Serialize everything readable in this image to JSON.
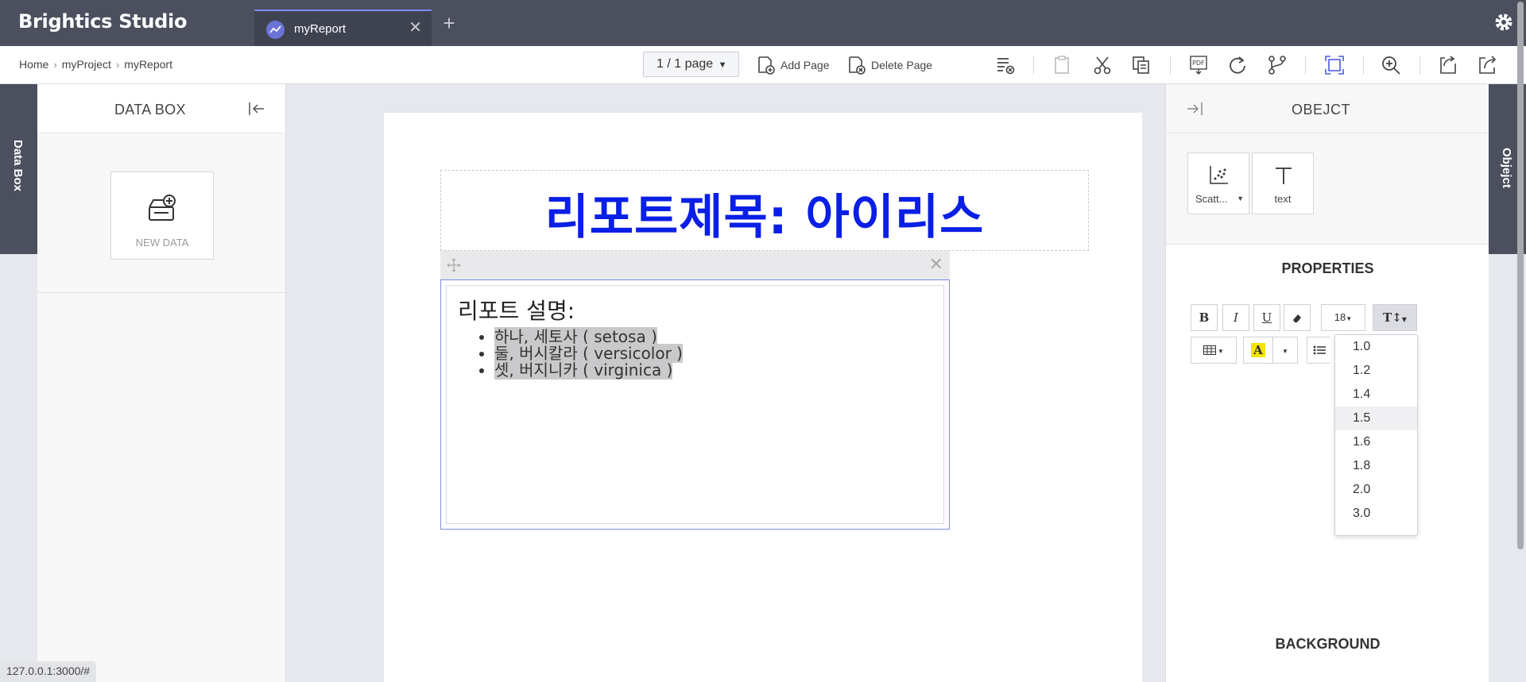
{
  "app": {
    "title": "Brightics Studio"
  },
  "tabs": [
    {
      "label": "myReport"
    }
  ],
  "breadcrumb": [
    "Home",
    "myProject",
    "myReport"
  ],
  "toolbar": {
    "page_select": "1 / 1 page",
    "add_page": "Add Page",
    "delete_page": "Delete Page"
  },
  "left_vtab": "Data Box",
  "right_vtab": "Objejct",
  "databox": {
    "title": "DATA BOX",
    "new_data": "NEW DATA"
  },
  "status_url": "127.0.0.1:3000/#",
  "report": {
    "title": "리포트제목: 아이리스",
    "description_heading": "리포트 설명:",
    "items": [
      "하나, 세토사 ( setosa )",
      "둘, 버시칼라 ( versicolor )",
      "셋, 버지니카 ( virginica )"
    ]
  },
  "object_panel": {
    "title": "OBEJCT",
    "objects": [
      {
        "label": "Scatt..."
      },
      {
        "label": "text"
      }
    ],
    "properties_title": "PROPERTIES",
    "background_title": "BACKGROUND",
    "font_size": "18",
    "bold": "B",
    "italic": "I",
    "underline": "U",
    "line_height_options": [
      "1.0",
      "1.2",
      "1.4",
      "1.5",
      "1.6",
      "1.8",
      "2.0",
      "3.0"
    ],
    "selected_option": "1.5"
  },
  "colors": {
    "accent": "#0a1fe6",
    "topbar": "#4b4f5e"
  }
}
